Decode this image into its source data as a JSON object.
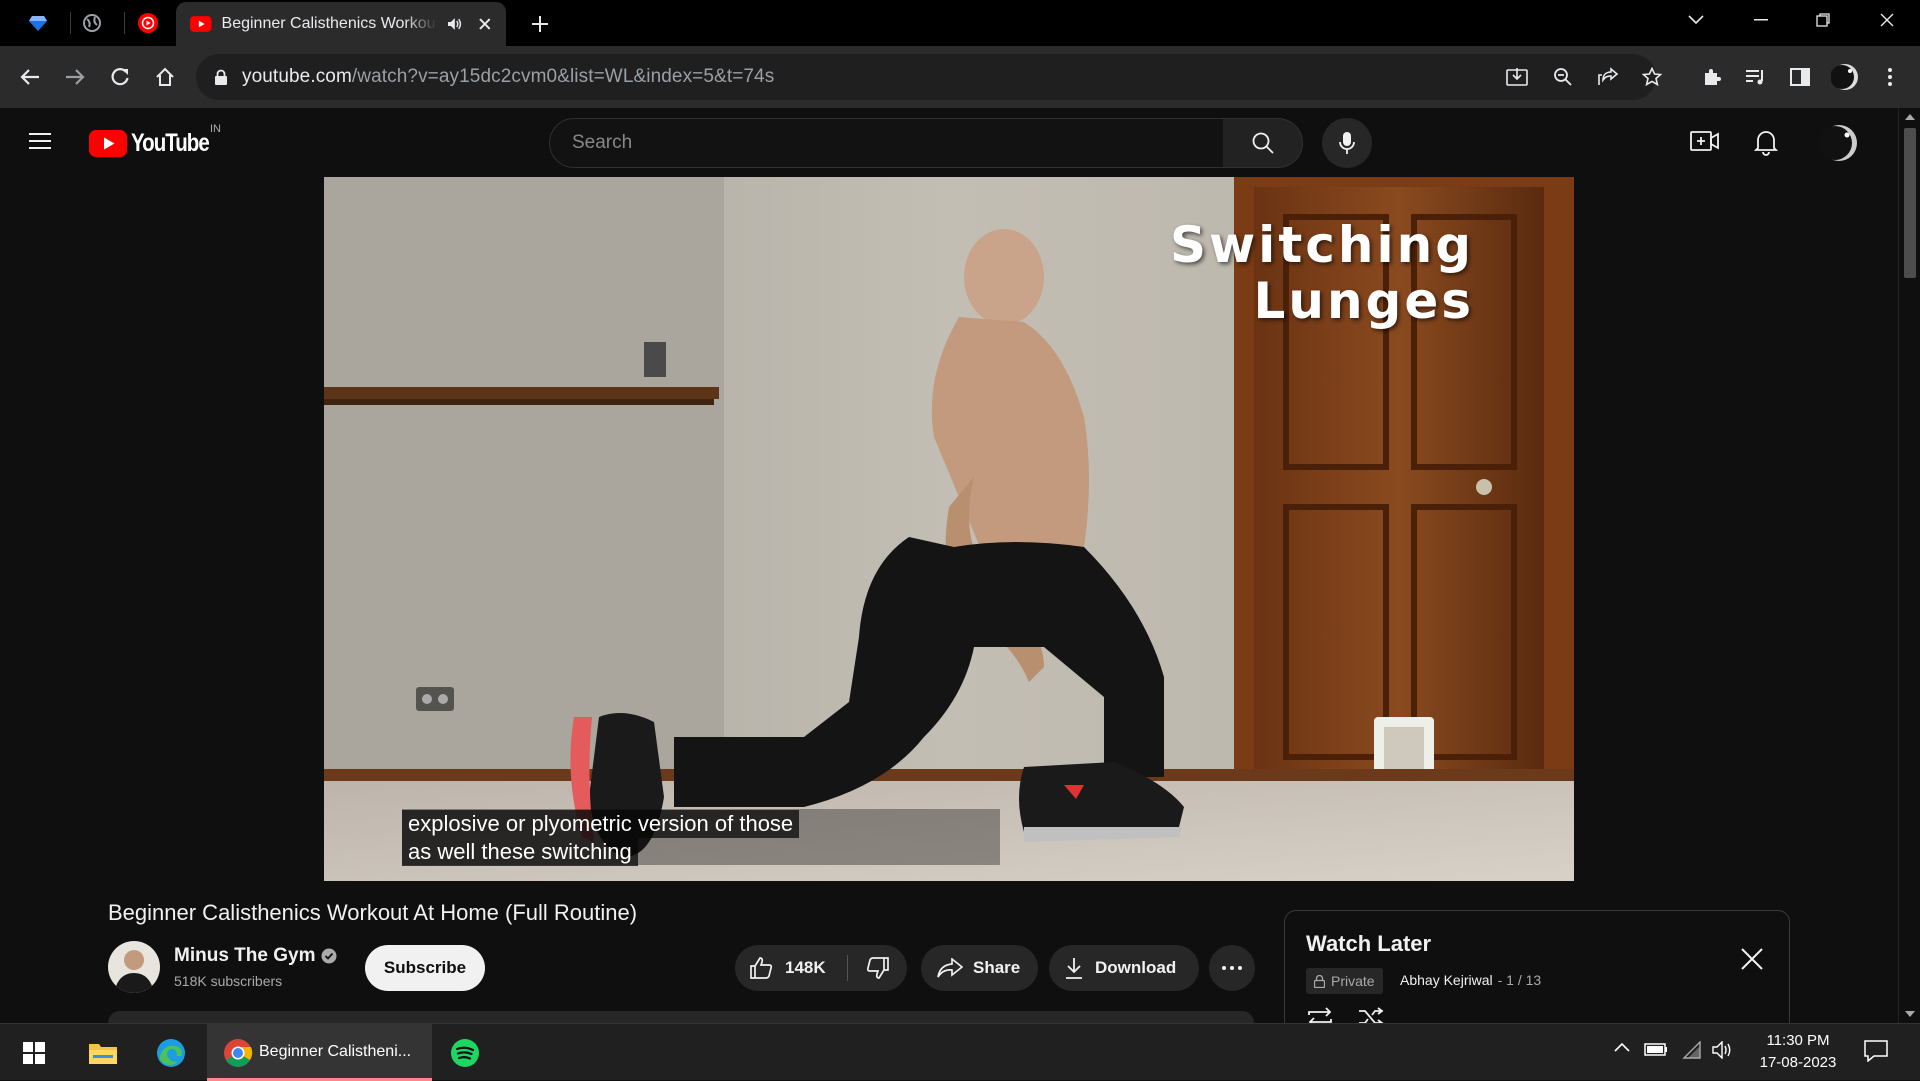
{
  "browser": {
    "active_tab_title": "Beginner Calisthenics Workout At Home (Full Routine)",
    "url_domain": "youtube.com",
    "url_path": "/watch?v=ay15dc2cvm0&list=WL&index=5&t=74s"
  },
  "youtube": {
    "logo_text": "YouTube",
    "region": "IN",
    "search_placeholder": "Search"
  },
  "video": {
    "overlay_title_line1": "Switching",
    "overlay_title_line2": "Lunges",
    "caption_line1": "explosive or plyometric version of those",
    "caption_line2": "as well these switching"
  },
  "video_info": {
    "title": "Beginner Calisthenics Workout At Home (Full Routine)",
    "channel_name": "Minus The Gym",
    "subscribers": "518K subscribers",
    "subscribe_label": "Subscribe",
    "likes": "148K",
    "share_label": "Share",
    "download_label": "Download"
  },
  "playlist": {
    "title": "Watch Later",
    "privacy": "Private",
    "owner": "Abhay Kejriwal",
    "position": "- 1 / 13"
  },
  "taskbar": {
    "chrome_window_label": "Beginner Calistheni...",
    "time": "11:30 PM",
    "date": "17-08-2023"
  },
  "colors": {
    "yt_red": "#ff0000",
    "bg": "#0f0f0f",
    "chip_bg": "#272727"
  }
}
